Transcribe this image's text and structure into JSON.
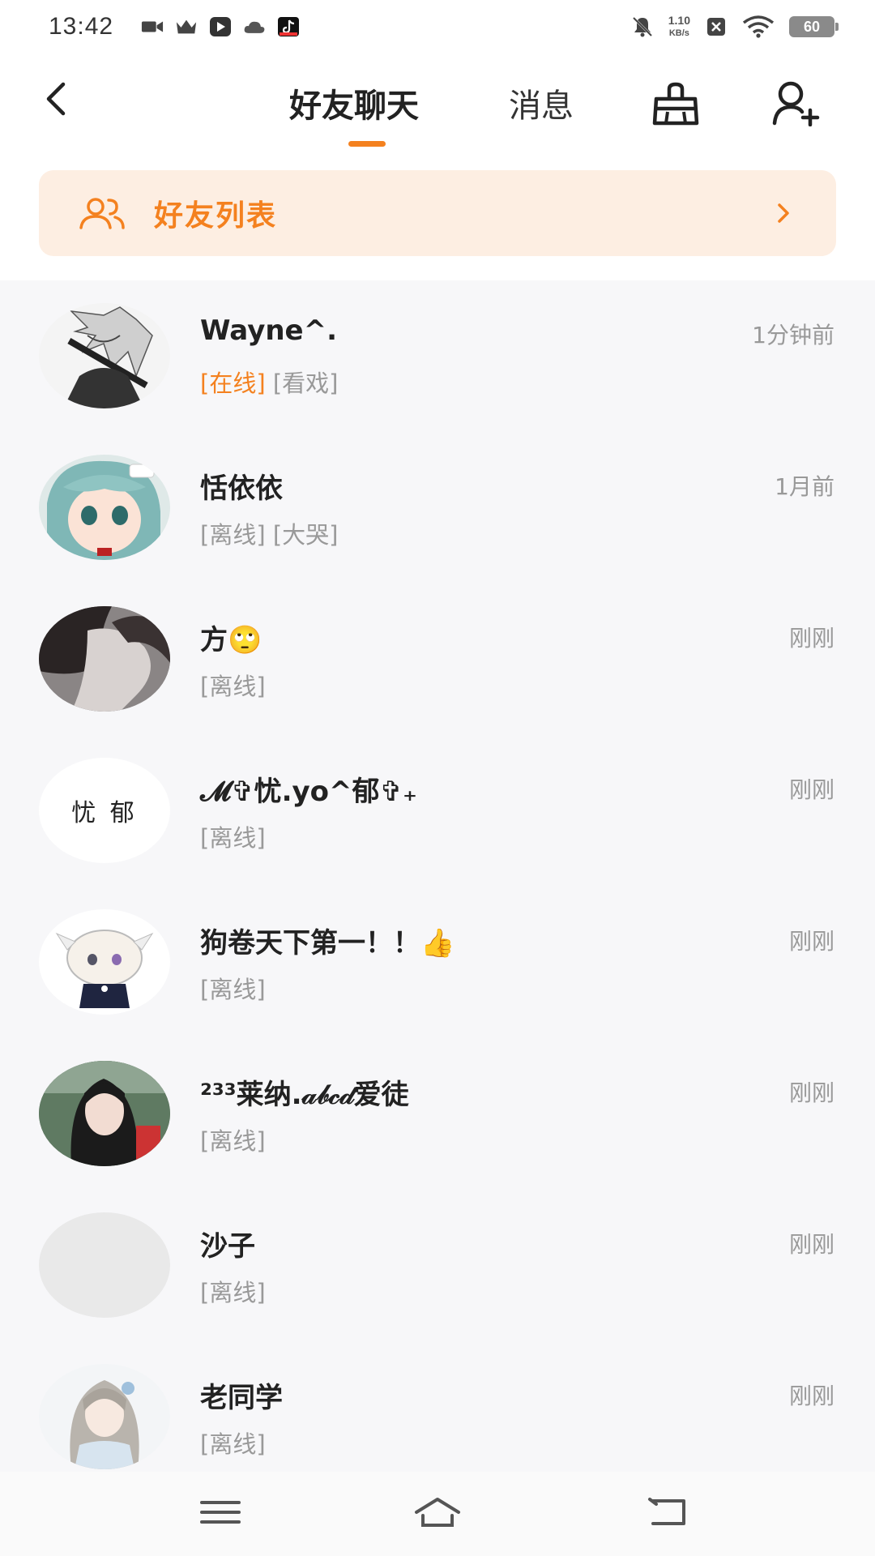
{
  "status_bar": {
    "time": "13:42",
    "net_speed_value": "1.10",
    "net_speed_unit": "KB/s",
    "battery": "60",
    "left_icons": [
      "video-icon",
      "crown-icon",
      "play-app-icon",
      "cloud-icon",
      "tiktok-icon"
    ],
    "right_icons": [
      "mute-bell-icon",
      "sim-off-icon",
      "wifi-icon",
      "battery-icon"
    ]
  },
  "header": {
    "tabs": [
      {
        "label": "好友聊天",
        "active": true
      },
      {
        "label": "消息",
        "active": false
      }
    ],
    "accent_color": "#f4811f",
    "icons": [
      "back-icon",
      "clean-icon",
      "add-friend-icon"
    ]
  },
  "banner": {
    "label": "好友列表",
    "background": "#fdeee2"
  },
  "friends": [
    {
      "name": "Wayne^.",
      "online_tag": "[在线]",
      "status_tag": "[看戏]",
      "time": "1分钟前"
    },
    {
      "name": "恬依依",
      "online_tag": "[离线]",
      "status_tag": "[大哭]",
      "time": "1月前"
    },
    {
      "name": "方🙄",
      "online_tag": "[离线]",
      "status_tag": "",
      "time": "刚刚"
    },
    {
      "name": "𝓜✞忧.yo^郁✞₊",
      "online_tag": "[离线]",
      "status_tag": "",
      "time": "刚刚",
      "avatar_text": "忧 郁"
    },
    {
      "name": "狗卷天下第一！！👍",
      "online_tag": "[离线]",
      "status_tag": "",
      "time": "刚刚"
    },
    {
      "name": "²³³莱纳.𝒶𝒷𝒸𝒹爱徒",
      "online_tag": "[离线]",
      "status_tag": "",
      "time": "刚刚"
    },
    {
      "name": "沙子",
      "online_tag": "[离线]",
      "status_tag": "",
      "time": "刚刚"
    },
    {
      "name": "老同学",
      "online_tag": "[离线]",
      "status_tag": "",
      "time": "刚刚"
    }
  ],
  "nav_bar": {
    "buttons": [
      "menu-icon",
      "home-icon",
      "back-nav-icon"
    ]
  }
}
